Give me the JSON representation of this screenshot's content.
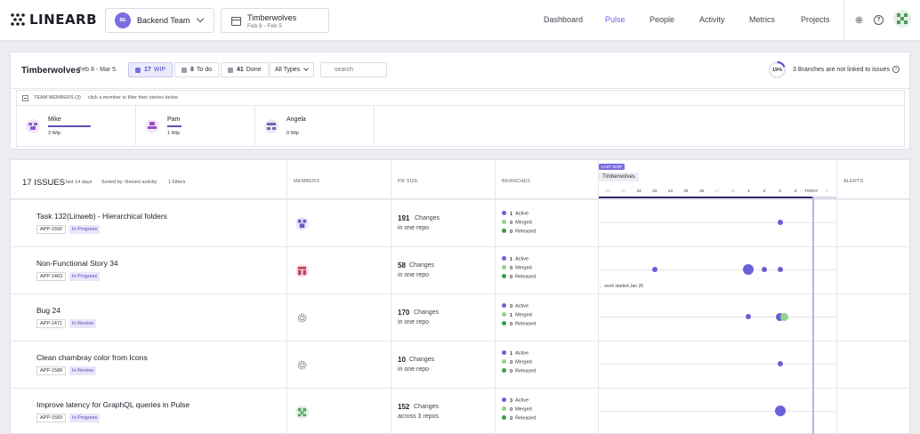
{
  "brand": {
    "name": "LINEARB"
  },
  "team_selector": {
    "avatar_initials": "BE",
    "name": "Backend Team"
  },
  "sprint_selector": {
    "name": "Timberwolves",
    "dates": "Feb 8 - Feb 5"
  },
  "nav": [
    {
      "label": "Dashboard",
      "active": false
    },
    {
      "label": "Pulse",
      "active": true
    },
    {
      "label": "People",
      "active": false
    },
    {
      "label": "Activity",
      "active": false
    },
    {
      "label": "Metrics",
      "active": false
    },
    {
      "label": "Projects",
      "active": false
    }
  ],
  "header_icons": [
    "gear-icon",
    "help-icon",
    "user-avatar"
  ],
  "filter_bar": {
    "title": "Timberwolves",
    "dates": "Feb 8 - Mar 5",
    "chips": [
      {
        "count": "17",
        "label": "WIP",
        "color": "#7a6ee0",
        "active": true
      },
      {
        "count": "8",
        "label": "To do",
        "color": "#9a9aaa",
        "active": false
      },
      {
        "count": "41",
        "label": "Done",
        "color": "#9a9aaa",
        "active": false
      }
    ],
    "type_filter": "All Types",
    "search_placeholder": "search",
    "unlinked_percent": "19%",
    "unlinked_percent_value": 19,
    "unlinked_text": "3 Branches are not linked to issues"
  },
  "team_members": {
    "label": "TEAM MEMBERS (3)",
    "hint": "click a member to filter their stories below",
    "members": [
      {
        "name": "Mike",
        "wip": "3 Wip",
        "wip_count": 3,
        "avatar_color": "#8b5cc8"
      },
      {
        "name": "Pam",
        "wip": "1 Wip",
        "wip_count": 1,
        "avatar_color": "#9b4fc4"
      },
      {
        "name": "Angela",
        "wip": "0 Wip",
        "wip_count": 0,
        "avatar_color": "#6a6ab8"
      }
    ]
  },
  "issues": {
    "title": "17 ISSUES",
    "period": "last 14 days",
    "sort": "Sorted by: Recent activity",
    "filters": "1 Filters",
    "columns": {
      "members": "MEMBERS",
      "pr_size": "PR SIZE",
      "branches": "BRANCHES",
      "alerts": "ALERTS"
    },
    "timeline": {
      "badge": "LAST SHIP",
      "label": "Timberwolves",
      "ticks": [
        "20",
        "21",
        "22",
        "23",
        "24",
        "25",
        "26",
        "27",
        "28",
        "1",
        "2",
        "3",
        "4",
        "TODAY",
        "5"
      ],
      "work_started": "work started Jan 26"
    },
    "branch_labels": {
      "active": "Active",
      "merged": "Merged",
      "released": "Released"
    },
    "colors": {
      "active": "#6b5fd8",
      "merged": "#8fd48a",
      "released": "#3f9a4f"
    },
    "rows": [
      {
        "title": "Task 132(Linweb) - Hierarchical folders",
        "key": "APP-1592",
        "status": "In Progress",
        "member_icon": "purple-pattern-avatar",
        "pr_count": "191",
        "pr_label": "Changes",
        "pr_scope": "in one repo",
        "active": "1",
        "merged": "0",
        "released": "0",
        "events": [
          {
            "tick": "3",
            "size": "small",
            "color": "#6b5fd8"
          }
        ]
      },
      {
        "title": "Non-Functional Story 34",
        "key": "APP-1463",
        "status": "In Progress",
        "member_icon": "red-pattern-avatar",
        "pr_count": "58",
        "pr_label": "Changes",
        "pr_scope": "in one repo",
        "active": "1",
        "merged": "0",
        "released": "0",
        "events": [
          {
            "tick": "23",
            "size": "small",
            "color": "#6b5fd8"
          },
          {
            "tick": "1",
            "size": "large",
            "color": "#6b5fd8"
          },
          {
            "tick": "2",
            "size": "small",
            "color": "#6b5fd8"
          },
          {
            "tick": "3",
            "size": "small",
            "color": "#6b5fd8"
          }
        ]
      },
      {
        "title": "Bug 24",
        "key": "APP-1471",
        "status": "In Review",
        "member_icon": "gear-avatar",
        "pr_count": "170",
        "pr_label": "Changes",
        "pr_scope": "in one repo",
        "active": "0",
        "merged": "1",
        "released": "0",
        "events": [
          {
            "tick": "1",
            "size": "small",
            "color": "#6b5fd8"
          },
          {
            "tick": "3",
            "size": "medium",
            "color": "#6b5fd8"
          },
          {
            "tick": "3",
            "size": "medium",
            "color": "#8fd48a"
          }
        ]
      },
      {
        "title": "Clean chambray color from Icons",
        "key": "APP-1588",
        "status": "In Review",
        "member_icon": "gear-avatar",
        "pr_count": "10",
        "pr_label": "Changes",
        "pr_scope": "in one repo",
        "active": "1",
        "merged": "0",
        "released": "0",
        "events": [
          {
            "tick": "3",
            "size": "small",
            "color": "#6b5fd8"
          }
        ]
      },
      {
        "title": "Improve latency for GraphQL queries in Pulse",
        "key": "APP-1583",
        "status": "In Progress",
        "member_icon": "green-pattern-avatar",
        "pr_count": "152",
        "pr_label": "Changes",
        "pr_scope": "across 3 repos",
        "active": "3",
        "merged": "0",
        "released": "0",
        "events": [
          {
            "tick": "3",
            "size": "large",
            "color": "#6b5fd8"
          }
        ]
      }
    ]
  }
}
